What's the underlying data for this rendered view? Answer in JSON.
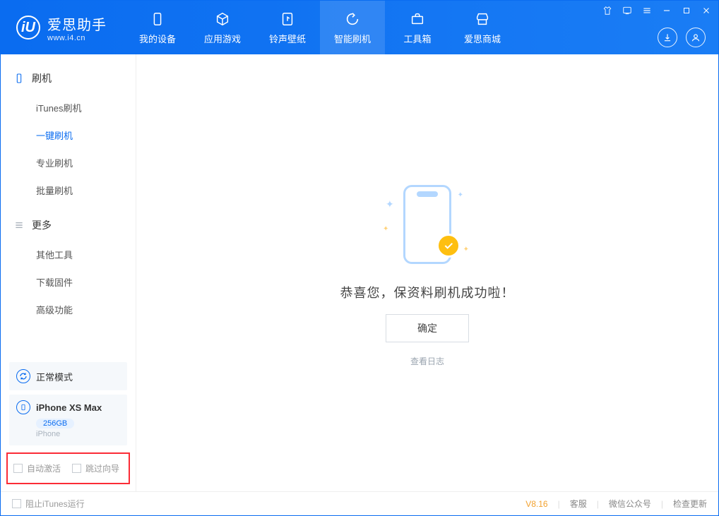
{
  "app": {
    "title": "爱思助手",
    "subtitle": "www.i4.cn",
    "logo_letter": "iU"
  },
  "nav": {
    "items": [
      {
        "label": "我的设备"
      },
      {
        "label": "应用游戏"
      },
      {
        "label": "铃声壁纸"
      },
      {
        "label": "智能刷机"
      },
      {
        "label": "工具箱"
      },
      {
        "label": "爱思商城"
      }
    ]
  },
  "sidebar": {
    "group1": {
      "title": "刷机",
      "items": [
        {
          "label": "iTunes刷机"
        },
        {
          "label": "一键刷机"
        },
        {
          "label": "专业刷机"
        },
        {
          "label": "批量刷机"
        }
      ]
    },
    "group2": {
      "title": "更多",
      "items": [
        {
          "label": "其他工具"
        },
        {
          "label": "下载固件"
        },
        {
          "label": "高级功能"
        }
      ]
    },
    "normal_mode": "正常模式",
    "device": {
      "name": "iPhone XS Max",
      "capacity": "256GB",
      "type": "iPhone"
    },
    "checks": {
      "auto_activate": "自动激活",
      "skip_guide": "跳过向导"
    }
  },
  "main": {
    "success_message": "恭喜您，保资料刷机成功啦！",
    "ok_button": "确定",
    "view_log": "查看日志"
  },
  "footer": {
    "block_itunes": "阻止iTunes运行",
    "version": "V8.16",
    "links": {
      "support": "客服",
      "wechat": "微信公众号",
      "check_update": "检查更新"
    }
  }
}
